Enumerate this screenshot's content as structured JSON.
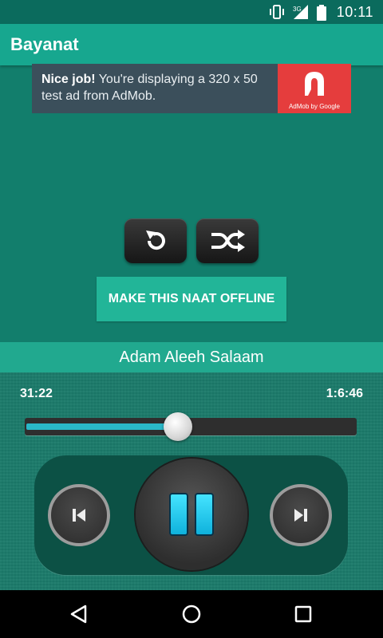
{
  "status_bar": {
    "time": "10:11",
    "icons": [
      "vibrate-icon",
      "signal-3g-icon",
      "battery-icon"
    ]
  },
  "app_bar": {
    "title": "Bayanat"
  },
  "ad": {
    "bold_text": "Nice job!",
    "text": " You're displaying a 320 x 50 test ad from AdMob.",
    "logo_caption": "AdMob by Google",
    "logo_color": "#e53d3d"
  },
  "controls": {
    "repeat_icon": "repeat-icon",
    "shuffle_icon": "shuffle-icon",
    "offline_button": "MAKE THIS NAAT OFFLINE"
  },
  "now_playing": {
    "title": "Adam Aleeh Salaam",
    "elapsed": "31:22",
    "duration": "1:6:46",
    "progress_fraction": 0.46
  },
  "player_buttons": {
    "previous": "previous-icon",
    "pause": "pause-icon",
    "next": "next-icon"
  },
  "colors": {
    "background": "#127e6c",
    "app_bar": "#17a78f",
    "accent": "#2ab8c8"
  }
}
